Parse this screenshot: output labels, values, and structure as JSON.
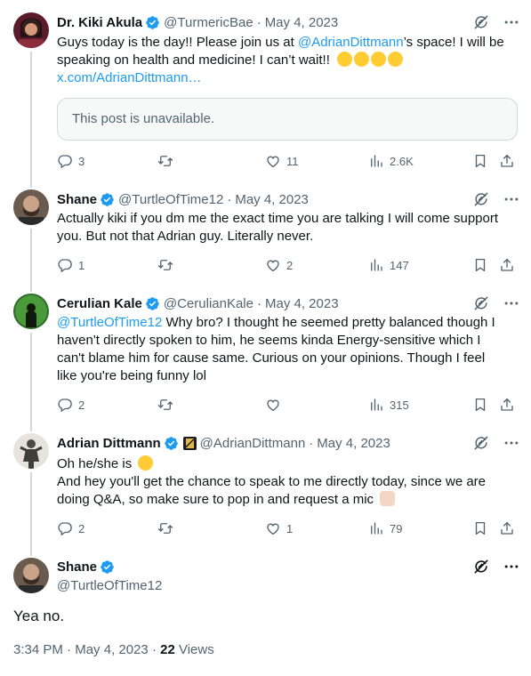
{
  "tweets": [
    {
      "name": "Dr. Kiki Akula",
      "handle": "@TurmericBae",
      "date": "May 4, 2023",
      "text_pre": "Guys today is the day!! Please join us at ",
      "mention": "@AdrianDittmann",
      "text_post": "’s space! I will be speaking on health and medicine! I can’t wait!!",
      "emoji": "star-struck-emoji",
      "link": "x.com/AdrianDittmann…",
      "quote": "This post is unavailable.",
      "replies": "3",
      "retweets": "",
      "likes": "11",
      "views": "2.6K"
    },
    {
      "name": "Shane",
      "handle": "@TurtleOfTime12",
      "date": "May 4, 2023",
      "line1": "Actually kiki if you dm me the exact time you are talking I will come support",
      "line2": "you. But not that Adrian guy. Literally never.",
      "replies": "1",
      "retweets": "",
      "likes": "2",
      "views": "147"
    },
    {
      "name": "Cerulian Kale",
      "handle": "@CerulianKale",
      "date": "May 4, 2023",
      "mention": "@TurtleOfTime12",
      "line1": " Why bro? I thought he seemed pretty balanced though I",
      "line2": "haven't directly spoken to him, he seems kinda Energy-sensitive which I",
      "line3": "can't blame him for cause same. Curious on your opinions. Though I feel",
      "line4": "like you're being funny lol",
      "replies": "2",
      "retweets": "",
      "likes": "",
      "views": "315"
    },
    {
      "name": "Adrian Dittmann",
      "handle": "@AdrianDittmann",
      "date": "May 4, 2023",
      "line1": "Oh he/she is",
      "line2": "And hey you'll get the chance to speak to me directly today, since we are",
      "line3": "doing Q&A, so make sure to pop in and request a mic",
      "replies": "2",
      "retweets": "",
      "likes": "1",
      "views": "79"
    }
  ],
  "main": {
    "name": "Shane",
    "handle": "@TurtleOfTime12",
    "text": "Yea no.",
    "time": "3:34 PM",
    "date": "May 4, 2023",
    "views_count": "22",
    "views_label": "Views"
  },
  "colors": {
    "blue": "#1d9bf0",
    "gray": "#536471",
    "border": "#cfd9de"
  }
}
